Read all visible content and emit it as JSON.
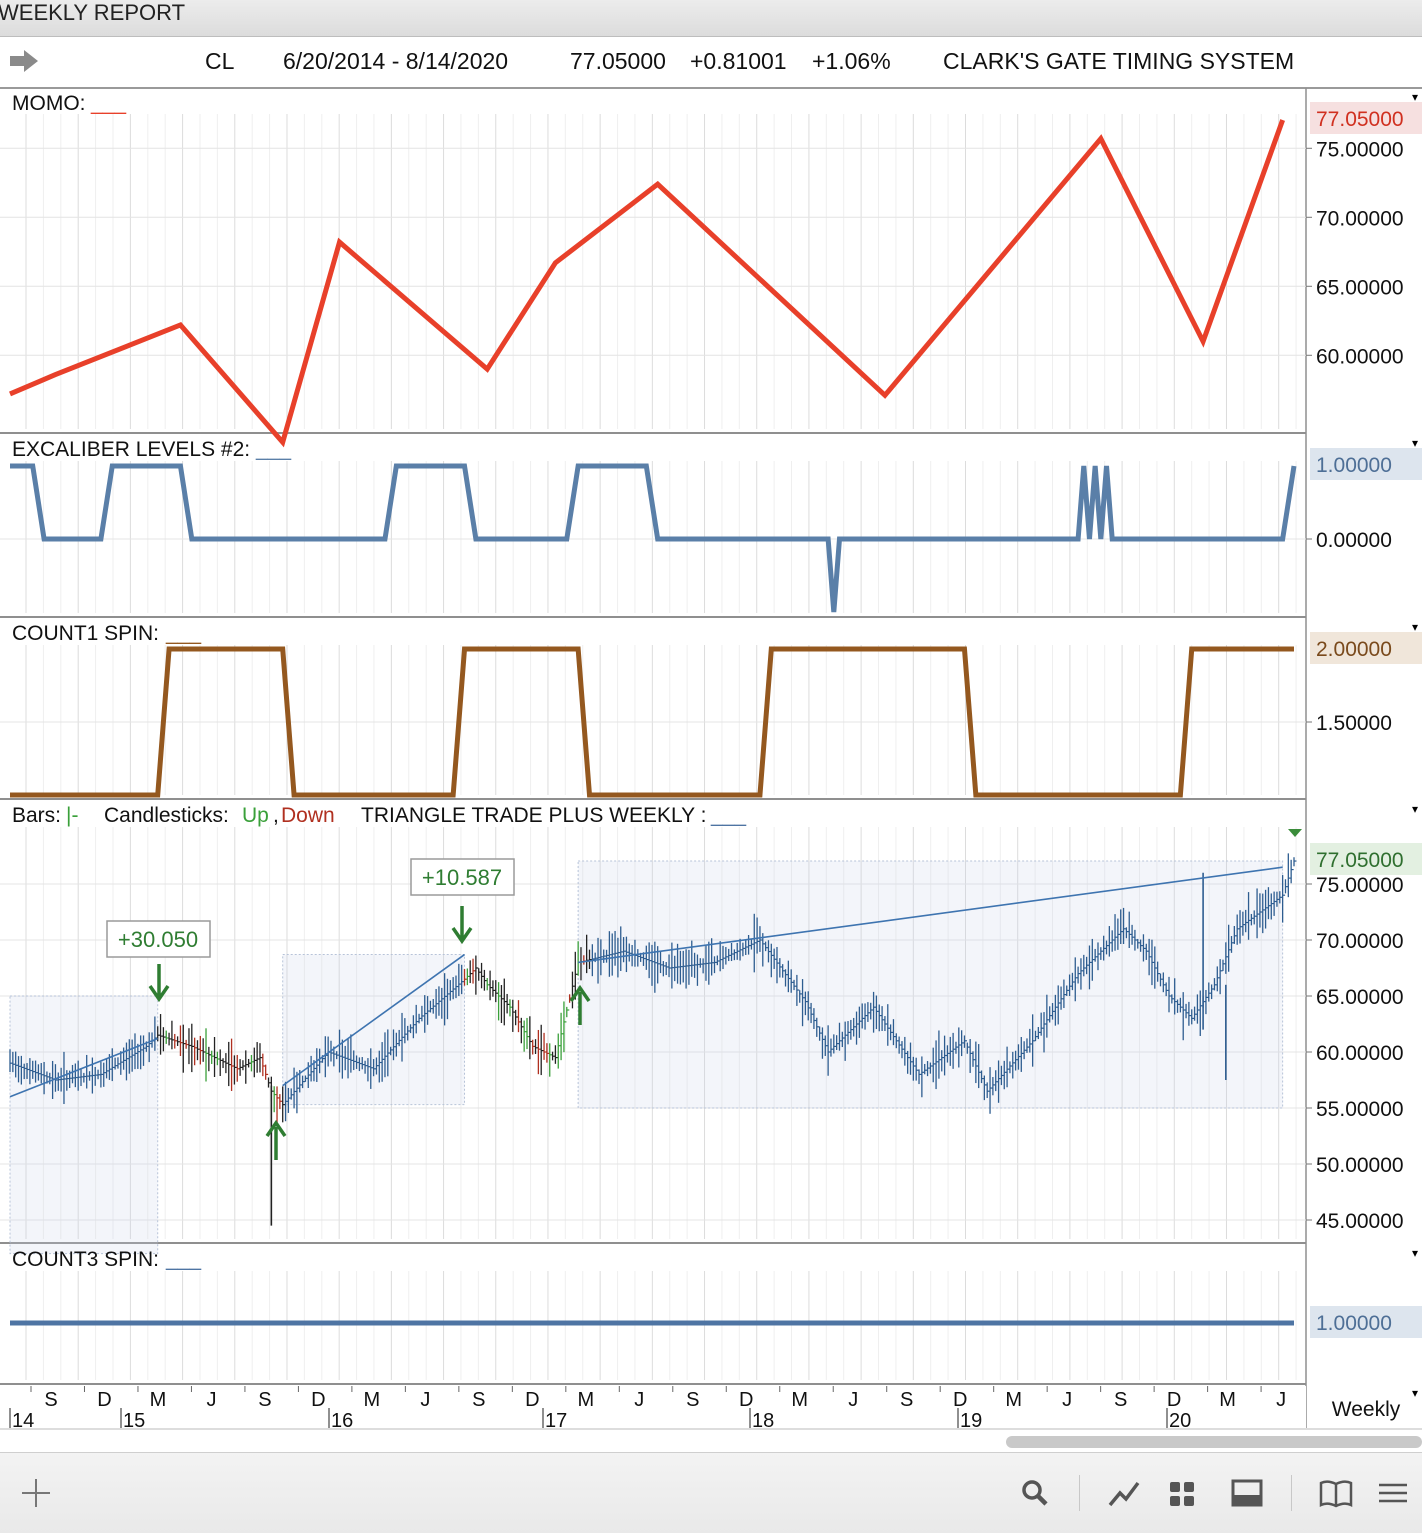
{
  "window": {
    "title": "WEEKLY REPORT"
  },
  "header": {
    "symbol": "CL",
    "date_range": "6/20/2014 - 8/14/2020",
    "last_price": "77.05000",
    "change": "+0.81001",
    "change_pct": "+1.06%",
    "system_name": "CLARK'S GATE TIMING SYSTEM"
  },
  "colors": {
    "momo": "#e8402a",
    "excaliber": "#5a7fa8",
    "count1": "#94581f",
    "count3": "#4e74a3",
    "bar_blue": "#2e5d90",
    "up": "#3aa03a",
    "down": "#b03020",
    "annotation": "#2f7d32",
    "tag_red_bg": "#f6e0e0",
    "tag_blue_bg": "#dde5ee",
    "tag_brown_bg": "#f0e6da",
    "tag_green_bg": "#e3f0e1"
  },
  "x_axis": {
    "months": [
      "S",
      "D",
      "M",
      "J",
      "S",
      "D",
      "M",
      "J",
      "S",
      "D",
      "M",
      "J",
      "S",
      "D",
      "M",
      "J",
      "S",
      "D",
      "M",
      "J",
      "S",
      "D",
      "M",
      "J"
    ],
    "years": [
      "14",
      "15",
      "16",
      "17",
      "18",
      "19",
      "20"
    ],
    "timeframe": "Weekly"
  },
  "panels": {
    "momo": {
      "label": "MOMO:",
      "line_glyph": "___",
      "last_value": "77.05000",
      "ticks": [
        "75.00000",
        "70.00000",
        "65.00000",
        "60.00000"
      ]
    },
    "excaliber": {
      "label": "EXCALIBER LEVELS #2:",
      "line_glyph": "___",
      "last_value": "1.00000",
      "ticks": [
        "0.00000"
      ]
    },
    "count1": {
      "label": "COUNT1 SPIN:",
      "line_glyph": "___",
      "last_value": "2.00000",
      "ticks": [
        "1.50000"
      ]
    },
    "price": {
      "legend": {
        "bars_label": "Bars:",
        "bars_glyph": "|-",
        "candles_label": "Candlesticks:",
        "up": "Up",
        "comma": ",",
        "down": "Down",
        "indicator": "TRIANGLE TRADE PLUS WEEKLY :",
        "indicator_glyph": "___"
      },
      "last_value": "77.05000",
      "ticks": [
        "75.00000",
        "70.00000",
        "65.00000",
        "60.00000",
        "55.00000",
        "50.00000",
        "45.00000"
      ],
      "annotations": [
        "+30.050",
        "+10.587"
      ]
    },
    "count3": {
      "label": "COUNT3 SPIN:",
      "line_glyph": "___",
      "last_value": "1.00000"
    }
  },
  "chart_data": [
    {
      "type": "line",
      "title": "MOMO",
      "series": [
        {
          "x": [
            0,
            4,
            15,
            24,
            29,
            42,
            48,
            57,
            77,
            96,
            105,
            112
          ],
          "values": [
            57.2,
            58.6,
            62.2,
            53.7,
            68.2,
            59.0,
            66.7,
            72.4,
            57.1,
            75.7,
            61.0,
            77.05
          ]
        }
      ],
      "ylim": [
        54.5,
        77.5
      ]
    },
    {
      "type": "line",
      "title": "EXCALIBER LEVELS #2",
      "series": [
        {
          "x": [
            0,
            2,
            3,
            8,
            9,
            15,
            16,
            33,
            34,
            40,
            41,
            49,
            50,
            56,
            57,
            72,
            72.5,
            73,
            94,
            94.5,
            95,
            95.5,
            96,
            96.5,
            97,
            112,
            113
          ],
          "values": [
            1,
            1,
            0,
            0,
            1,
            1,
            0,
            0,
            1,
            1,
            0,
            0,
            1,
            1,
            0,
            0,
            -1,
            0,
            0,
            1,
            0,
            1,
            0,
            1,
            0,
            0,
            1
          ]
        }
      ],
      "ylim": [
        -1.05,
        1.05
      ]
    },
    {
      "type": "line",
      "title": "COUNT1 SPIN",
      "series": [
        {
          "x": [
            0,
            13,
            14,
            24,
            25,
            39,
            40,
            50,
            51,
            66,
            67,
            84,
            85,
            103,
            104,
            113
          ],
          "values": [
            1,
            1,
            2,
            2,
            1,
            1,
            2,
            2,
            1,
            1,
            2,
            2,
            1,
            1,
            2,
            2
          ]
        }
      ],
      "ylim": [
        1,
        2
      ]
    },
    {
      "type": "line",
      "title": "COUNT3 SPIN",
      "series": [
        {
          "x": [
            0,
            113
          ],
          "values": [
            1,
            1
          ]
        }
      ]
    },
    {
      "type": "bar",
      "title": "TRIANGLE TRADE PLUS WEEKLY",
      "xlabel": "",
      "ylabel": "",
      "ylim": [
        43,
        78
      ],
      "series": [
        {
          "x": [
            0,
            4,
            8,
            12,
            13,
            16,
            20,
            22,
            23,
            24,
            28,
            32,
            36,
            40,
            41,
            42,
            44,
            46,
            48,
            50,
            54,
            58,
            62,
            66,
            70,
            72,
            76,
            80,
            84,
            86,
            90,
            94,
            98,
            100,
            102,
            104,
            106,
            108,
            112,
            113
          ],
          "values": [
            59.0,
            57.5,
            58.0,
            60.5,
            61.5,
            60.5,
            58.5,
            59.5,
            56.5,
            55.3,
            60.0,
            58.5,
            63.0,
            66.5,
            67.5,
            66.0,
            64.0,
            60.5,
            59.5,
            68.0,
            69.0,
            67.5,
            68.0,
            70.0,
            64.5,
            60.0,
            64.0,
            58.0,
            61.0,
            56.5,
            61.0,
            67.0,
            71.0,
            69.0,
            65.0,
            63.0,
            66.0,
            71.0,
            74.0,
            77.05
          ]
        }
      ],
      "trendlines": [
        {
          "x": [
            0,
            13
          ],
          "values": [
            56.0,
            61.2
          ]
        },
        {
          "x": [
            24,
            40
          ],
          "values": [
            57.0,
            68.7
          ]
        },
        {
          "x": [
            50,
            112
          ],
          "values": [
            68.0,
            76.5
          ]
        }
      ],
      "annotations": [
        {
          "label": "+30.050",
          "x": 13,
          "arrow": "down"
        },
        {
          "label": "+10.587",
          "x": 40,
          "arrow": "down"
        },
        {
          "arrow": "up",
          "x": 23
        },
        {
          "arrow": "up",
          "x": 50
        }
      ]
    }
  ]
}
